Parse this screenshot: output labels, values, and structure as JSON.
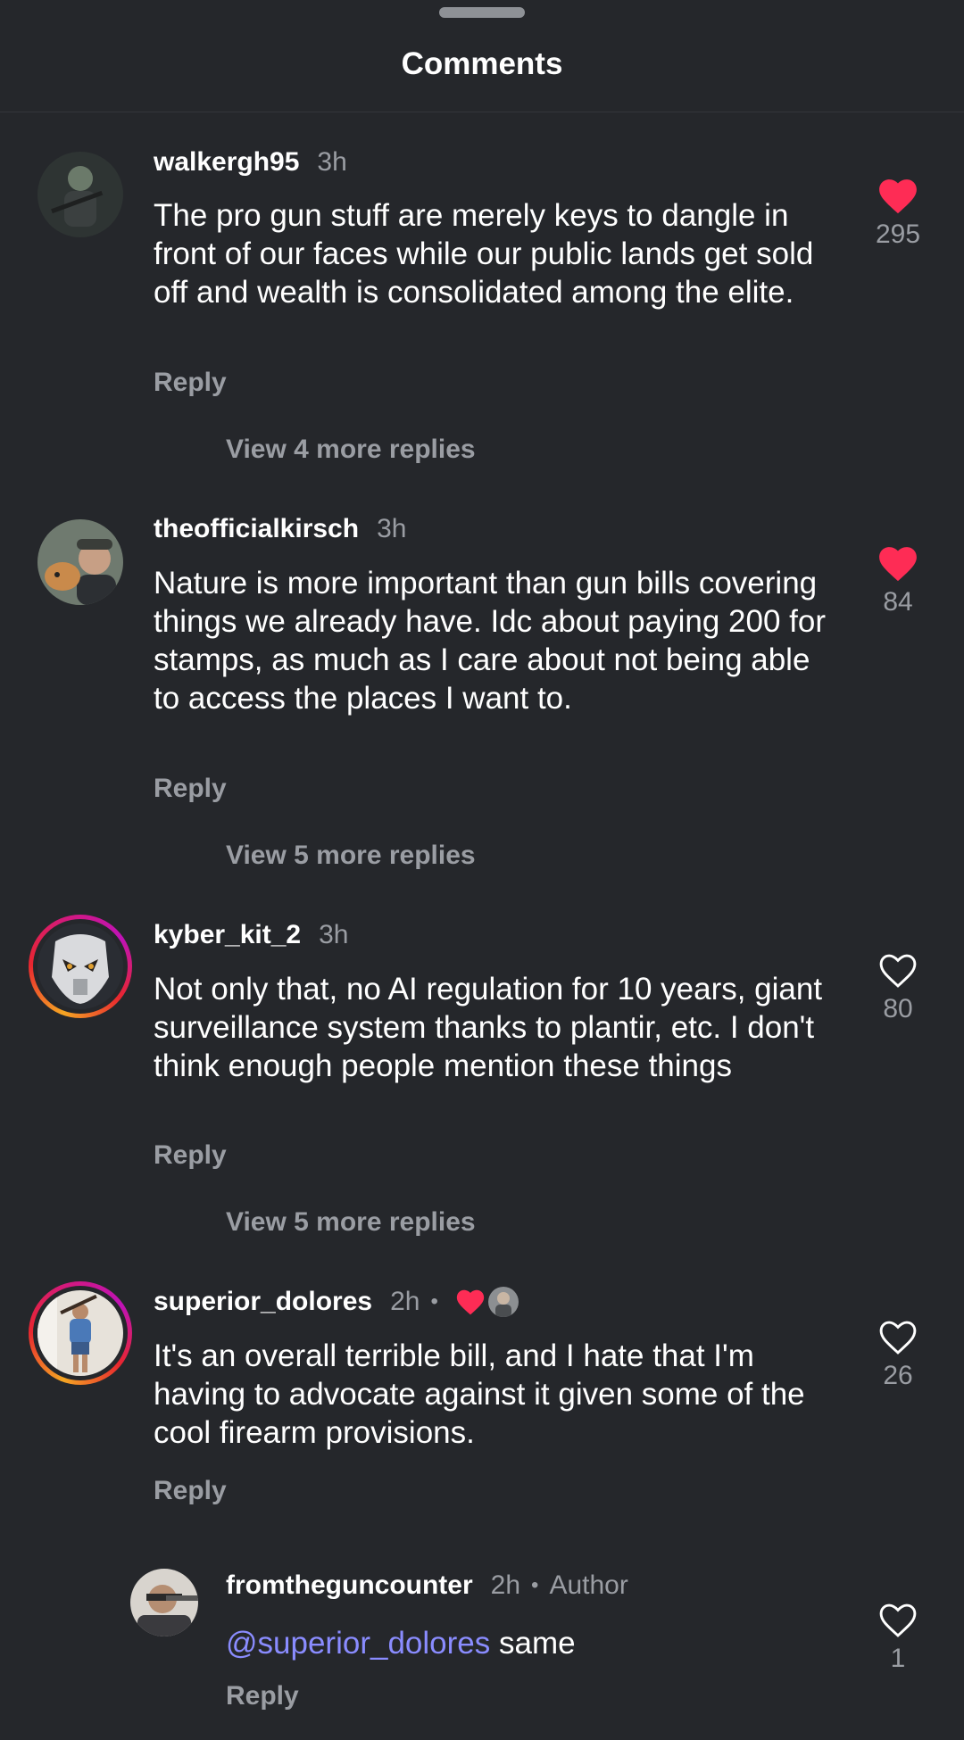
{
  "header": {
    "title": "Comments"
  },
  "comments": [
    {
      "username": "walkergh95",
      "time": "3h",
      "text": "The pro gun stuff are merely keys to dangle in front of our faces while our public lands get sold off and wealth is consolidated among the elite.",
      "reply_label": "Reply",
      "view_more": "View 4 more replies",
      "likes": "295",
      "liked": true
    },
    {
      "username": "theofficialkirsch",
      "time": "3h",
      "text": "Nature is more important than gun bills covering things we already have. Idc about paying 200 for stamps, as much as I care about not being able to access the places I want to.",
      "reply_label": "Reply",
      "view_more": "View 5 more replies",
      "likes": "84",
      "liked": true
    },
    {
      "username": "kyber_kit_2",
      "time": "3h",
      "text": "Not only that, no AI regulation for 10 years, giant surveillance system thanks to plantir, etc. I don't think enough people mention these things",
      "reply_label": "Reply",
      "view_more": "View 5 more replies",
      "likes": "80",
      "liked": false
    },
    {
      "username": "superior_dolores",
      "time": "2h",
      "separator": "•",
      "text": "It's an overall terrible bill, and I hate that I'm having to advocate against it given some of the cool firearm provisions.",
      "reply_label": "Reply",
      "likes": "26",
      "liked": false
    }
  ],
  "reply": {
    "username": "fromtheguncounter",
    "time": "2h",
    "separator": "•",
    "author_tag": "Author",
    "mention": "@superior_dolores",
    "text": " same",
    "reply_label": "Reply",
    "likes": "1",
    "liked": false
  },
  "colors": {
    "background": "#25272b",
    "heart_red": "#fe2c55",
    "muted": "#9a9da3",
    "mention": "#8a8cff"
  }
}
